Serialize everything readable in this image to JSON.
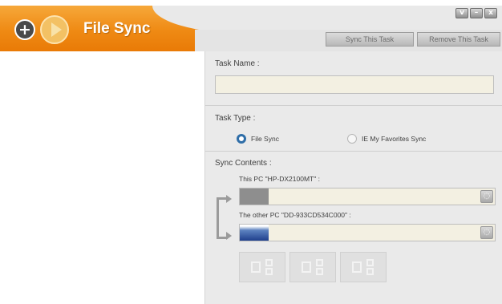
{
  "header": {
    "title": "File Sync",
    "sync_task_label": "Sync This Task",
    "remove_task_label": "Remove This Task",
    "window_controls": [
      "chevron-down-icon",
      "minimize-icon",
      "close-icon"
    ]
  },
  "task": {
    "name_label": "Task Name :",
    "name_value": ""
  },
  "task_type": {
    "label": "Task Type :",
    "options": [
      {
        "label": "File Sync",
        "selected": true
      },
      {
        "label": "IE My Favorites Sync",
        "selected": false
      }
    ]
  },
  "sync_contents": {
    "label": "Sync Contents :",
    "this_pc_label": "This PC \"HP-DX2100MT\" :",
    "this_pc_path": "",
    "other_pc_label": "The other PC \"DD-933CD534C000\" :",
    "other_pc_path": ""
  },
  "colors": {
    "header_orange": "#ef8a14",
    "radio_selected": "#2f6ea8",
    "input_bg": "#f3f0e2"
  }
}
